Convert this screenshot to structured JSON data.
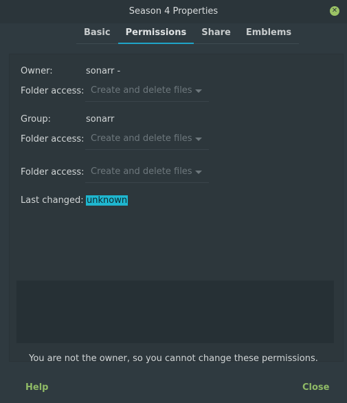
{
  "window": {
    "title": "Season 4 Properties"
  },
  "tabs": [
    {
      "label": "Basic"
    },
    {
      "label": "Permissions"
    },
    {
      "label": "Share"
    },
    {
      "label": "Emblems"
    }
  ],
  "owner": {
    "label": "Owner:",
    "value": "sonarr -",
    "access_label": "Folder access:",
    "access_value": "Create and delete files"
  },
  "group": {
    "label": "Group:",
    "value": "sonarr",
    "access_label": "Folder access:",
    "access_value": "Create and delete files"
  },
  "others": {
    "access_label": "Folder access:",
    "access_value": "Create and delete files"
  },
  "last_changed": {
    "label": "Last changed:",
    "value": "unknown"
  },
  "notice": "You are not the owner, so you cannot change these permissions.",
  "buttons": {
    "help": "Help",
    "close": "Close"
  },
  "colors": {
    "accent": "#1fa5c8",
    "button_text": "#8fba66",
    "close_icon": "#9bc365"
  }
}
